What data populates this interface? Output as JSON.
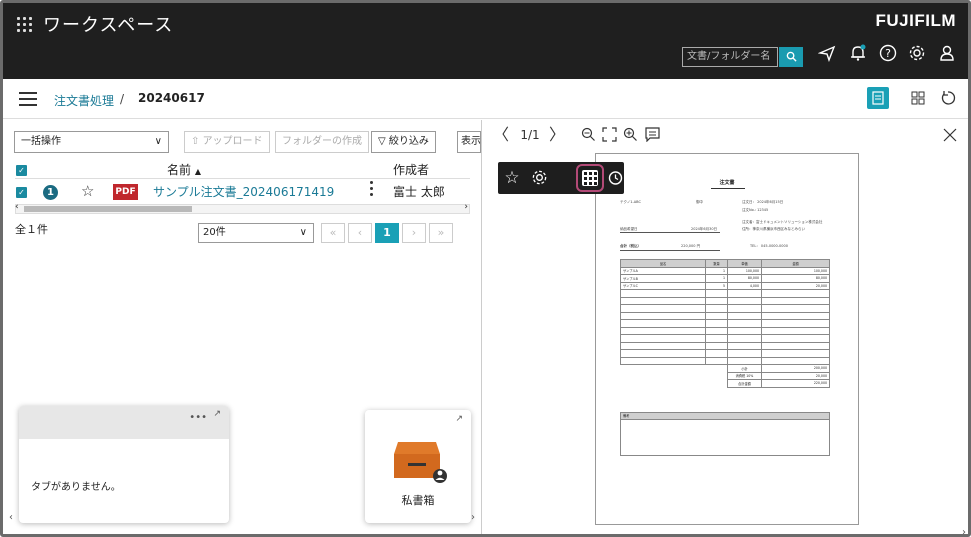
{
  "header": {
    "workspace_title": "ワークスペース",
    "brand": "FUJIFILM",
    "search_placeholder": "文書/フォルダー名",
    "icons": [
      "search-icon",
      "send-icon",
      "notification-bell-icon",
      "help-icon",
      "settings-icon",
      "user-icon"
    ]
  },
  "breadcrumb": {
    "parent": "注文書処理",
    "separator": "/",
    "current": "20240617"
  },
  "toolbar": {
    "bulk_action": "一括操作",
    "upload": "アップロード",
    "create_folder": "フォルダーの作成",
    "filter": "絞り込み",
    "display": "表示"
  },
  "table": {
    "col_name": "名前",
    "col_creator": "作成者",
    "rows": [
      {
        "version": "1",
        "type": "PDF",
        "name": "サンプル注文書_202406171419",
        "creator": "富士 太郎"
      }
    ]
  },
  "pagination": {
    "count_label": "全１件",
    "page_size": "20件",
    "current_page": "1"
  },
  "panels": {
    "tabs_empty": "タブがありません。",
    "private_box": "私書箱"
  },
  "viewer": {
    "page_indicator": "1/1"
  },
  "document": {
    "title": "注文書",
    "to_line": "テクノ1-ABC",
    "honorific": "御中",
    "date_line": "注文日： 2024年6月15日",
    "order_no": "注文No.: 12345",
    "company_line": "注文者：富士ドキュメントソリューション株式会社",
    "address_line": "住所：神奈川県横浜市西区みなとみらい",
    "delivery_label": "納品希望日",
    "delivery_date": "2024年6月30日",
    "total_label": "合計（税込）",
    "total_value": "220,000 円",
    "tel": "TEL： 045-0000-0000",
    "columns": [
      "品名",
      "数量",
      "単価",
      "金額"
    ],
    "items": [
      [
        "サンプルA",
        "1",
        "100,000",
        "100,000"
      ],
      [
        "サンプルB",
        "1",
        "80,000",
        "80,000"
      ],
      [
        "サンプルC",
        "5",
        "4,000",
        "20,000"
      ]
    ],
    "subtotal_label": "小計",
    "subtotal": "200,000",
    "tax_label": "消費税 10%",
    "tax": "20,000",
    "grand_label": "合計金額",
    "grand": "220,000",
    "remarks_label": "備考"
  },
  "colors": {
    "topbar": "#1f1f1f",
    "accent": "#1aa0b6",
    "link": "#1a7a96",
    "pdf": "#c0272d",
    "highlight": "#b34a77"
  }
}
